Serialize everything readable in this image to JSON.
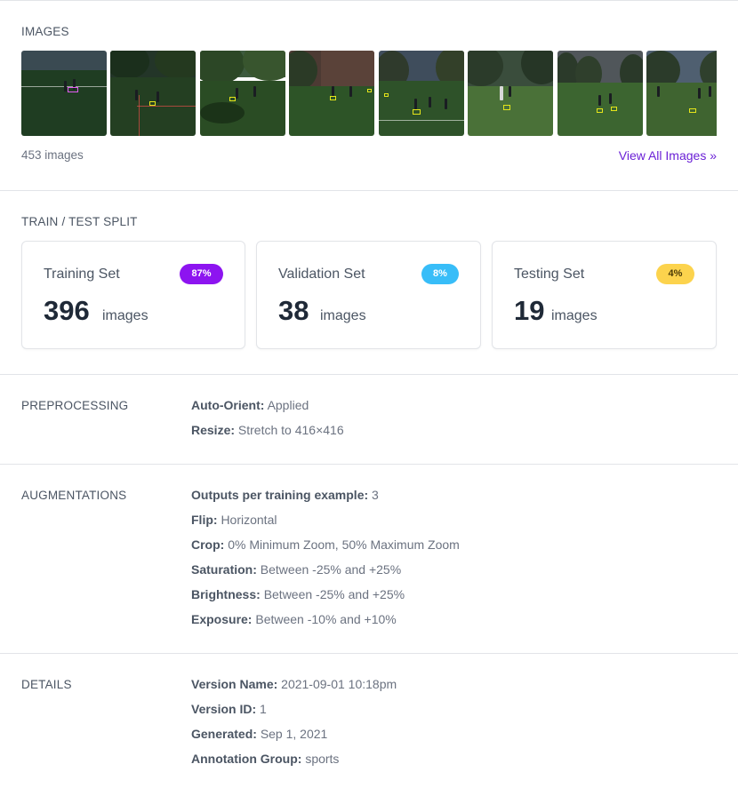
{
  "images": {
    "section_title": "IMAGES",
    "count_label": "453 images",
    "view_all_label": "View All Images »",
    "thumbnails": [
      "thumbnail-1",
      "thumbnail-2",
      "thumbnail-3",
      "thumbnail-4",
      "thumbnail-5",
      "thumbnail-6",
      "thumbnail-7",
      "thumbnail-8"
    ]
  },
  "split": {
    "section_title": "TRAIN / TEST SPLIT",
    "cards": [
      {
        "title": "Training Set",
        "percent": "87%",
        "count": "396",
        "unit": "images",
        "badge_color": "#8d14f0",
        "badge_text_color": "#ffffff"
      },
      {
        "title": "Validation Set",
        "percent": "8%",
        "count": "38",
        "unit": "images",
        "badge_color": "#38bdf8",
        "badge_text_color": "#ffffff"
      },
      {
        "title": "Testing Set",
        "percent": "4%",
        "count": "19",
        "unit": "images",
        "badge_color": "#fcd34d",
        "badge_text_color": "#4b3b06"
      }
    ]
  },
  "preprocessing": {
    "section_title": "PREPROCESSING",
    "items": [
      {
        "key": "Auto-Orient:",
        "value": "Applied"
      },
      {
        "key": "Resize:",
        "value": "Stretch to 416×416"
      }
    ]
  },
  "augmentations": {
    "section_title": "AUGMENTATIONS",
    "items": [
      {
        "key": "Outputs per training example:",
        "value": "3"
      },
      {
        "key": "Flip:",
        "value": "Horizontal"
      },
      {
        "key": "Crop:",
        "value": "0% Minimum Zoom, 50% Maximum Zoom"
      },
      {
        "key": "Saturation:",
        "value": "Between -25% and +25%"
      },
      {
        "key": "Brightness:",
        "value": "Between -25% and +25%"
      },
      {
        "key": "Exposure:",
        "value": "Between -10% and +10%"
      }
    ]
  },
  "details": {
    "section_title": "DETAILS",
    "items": [
      {
        "key": "Version Name:",
        "value": "2021-09-01 10:18pm"
      },
      {
        "key": "Version ID:",
        "value": "1"
      },
      {
        "key": "Generated:",
        "value": "Sep 1, 2021"
      },
      {
        "key": "Annotation Group:",
        "value": "sports"
      }
    ]
  }
}
